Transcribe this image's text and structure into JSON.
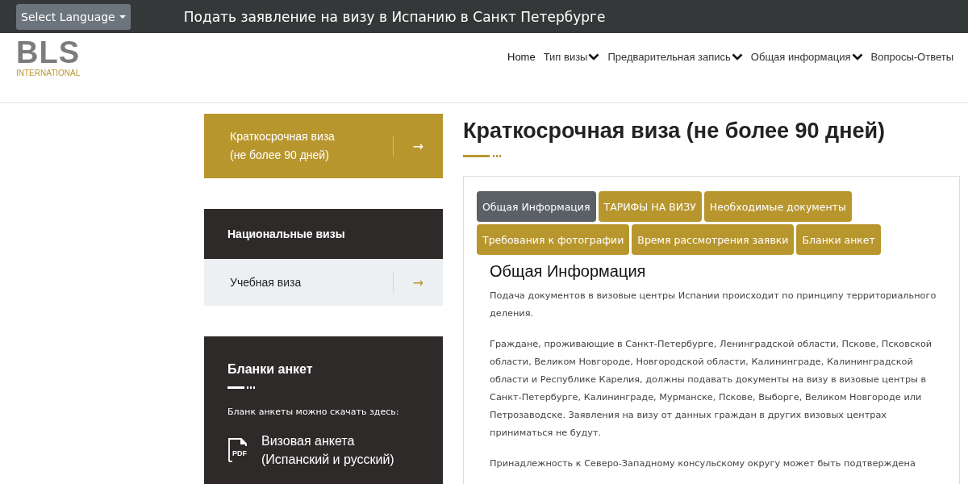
{
  "top_bar": {
    "language_select": "Select Language",
    "title": "Подать заявление на визу в Испанию в Санкт Петербурге"
  },
  "header": {
    "logo": {
      "mark": "BLS",
      "subtitle": "INTERNATIONAL"
    },
    "nav": [
      {
        "label": "Home",
        "dropdown": false
      },
      {
        "label": "Тип визы",
        "dropdown": true
      },
      {
        "label": "Предварительная запись",
        "dropdown": true
      },
      {
        "label": "Общая информация",
        "dropdown": true
      },
      {
        "label": "Вопросы-Ответы",
        "dropdown": false
      }
    ]
  },
  "sidebar": {
    "featured": {
      "lines": [
        "Краткосрочная виза",
        "(не более 90 дней)"
      ],
      "arrow": "→"
    },
    "national": {
      "title": "Национальные визы",
      "items": [
        {
          "label": "Учебная виза",
          "arrow": "→"
        }
      ]
    },
    "forms": {
      "title": "Бланки анкет",
      "text": "Бланк анкеты можно скачать здесь:",
      "file": {
        "badge": "PDF",
        "lines": [
          "Визовая анкета",
          "(Испанский и русский)"
        ]
      }
    }
  },
  "main": {
    "title": "Краткосрочная виза (не более 90 дней)",
    "tabs": [
      {
        "label": "Общая Информация",
        "selected": true
      },
      {
        "label": "ТАРИФЫ НА ВИЗУ",
        "selected": false
      },
      {
        "label": "Необходимые документы",
        "selected": false
      },
      {
        "label": "Требования к фотографии",
        "selected": false
      },
      {
        "label": "Время рассмотрения заявки",
        "selected": false
      },
      {
        "label": "Бланки анкет",
        "selected": false
      }
    ],
    "section_title": "Общая Информация",
    "paragraphs": [
      "Подача документов в визовые центры Испании происходит по принципу территориального деления.",
      "Граждане, проживающие в Санкт-Петербурге, Ленинградской области, Пскове, Псковской области, Великом Новгороде, Новгородской области, Калининграде, Калининградской области и Республике Карелия, должны подавать документы на визу в визовые центры в Санкт-Петербурге, Калининграде, Мурманске, Пскове, Выборге, Великом Новгороде или Петрозаводске. Заявления на визу от данных граждан в других визовых центрах приниматься не будут.",
      "Принадлежность к Северо-Западному консульскому округу может быть подтверждена"
    ]
  }
}
